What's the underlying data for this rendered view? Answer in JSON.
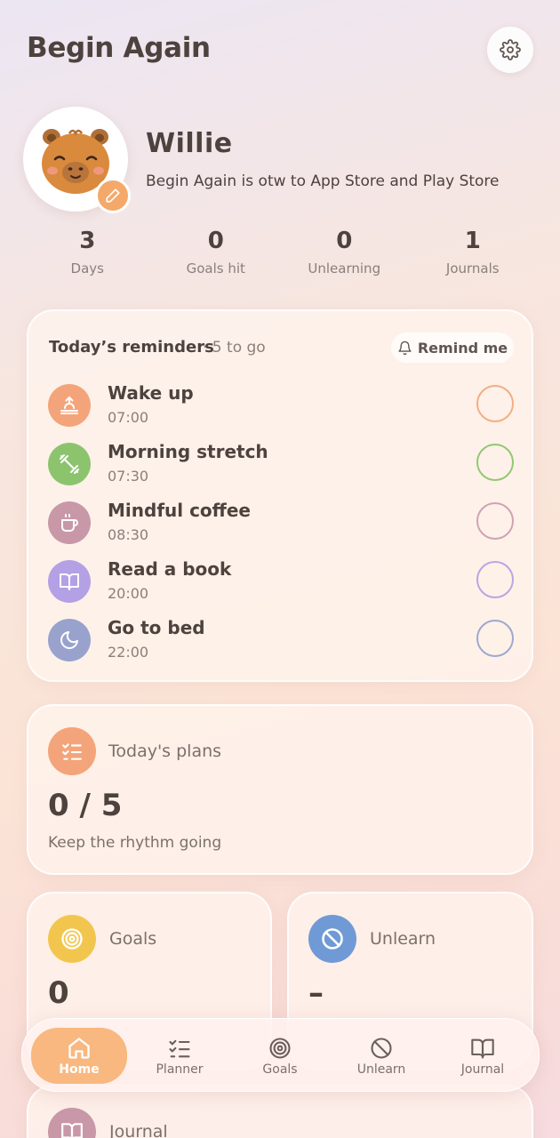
{
  "header": {
    "title": "Begin Again",
    "settings_icon": "gear-icon"
  },
  "profile": {
    "name": "Willie",
    "status": "Begin Again is otw to App Store and Play Store",
    "avatar_icon": "capybara-avatar",
    "edit_icon": "pencil-icon"
  },
  "stats": [
    {
      "value": "3",
      "label": "Days"
    },
    {
      "value": "0",
      "label": "Goals hit"
    },
    {
      "value": "0",
      "label": "Unlearning"
    },
    {
      "value": "1",
      "label": "Journals"
    }
  ],
  "reminders": {
    "title": "Today’s reminders",
    "count": "· 5 to go",
    "remind_button": "Remind me",
    "items": [
      {
        "name": "Wake up",
        "time": "07:00",
        "icon": "sunrise-icon",
        "color": "#f4a47a"
      },
      {
        "name": "Morning stretch",
        "time": "07:30",
        "icon": "dumbbell-icon",
        "color": "#8cc46e"
      },
      {
        "name": "Mindful coffee",
        "time": "08:30",
        "icon": "coffee-icon",
        "color": "#c898a8"
      },
      {
        "name": "Read a book",
        "time": "20:00",
        "icon": "book-icon",
        "color": "#b4a0e4"
      },
      {
        "name": "Go to bed",
        "time": "22:00",
        "icon": "moon-icon",
        "color": "#98a2cc"
      }
    ]
  },
  "plans": {
    "title": "Today's plans",
    "value": "0 / 5",
    "subtitle": "Keep the rhythm going",
    "icon": "checklist-icon"
  },
  "goals": {
    "title": "Goals",
    "value": "0",
    "icon": "target-icon",
    "color": "#f2c64e"
  },
  "unlearn": {
    "title": "Unlearn",
    "value": "–",
    "icon": "ban-icon",
    "color": "#6f9ad6"
  },
  "journal": {
    "title": "Journal",
    "icon": "book-icon",
    "color": "#c898a8"
  },
  "nav": {
    "active": "Home",
    "items": [
      {
        "label": "Home",
        "icon": "home-icon"
      },
      {
        "label": "Planner",
        "icon": "checklist-icon"
      },
      {
        "label": "Goals",
        "icon": "target-icon"
      },
      {
        "label": "Unlearn",
        "icon": "ban-icon"
      },
      {
        "label": "Journal",
        "icon": "book-icon"
      }
    ]
  }
}
